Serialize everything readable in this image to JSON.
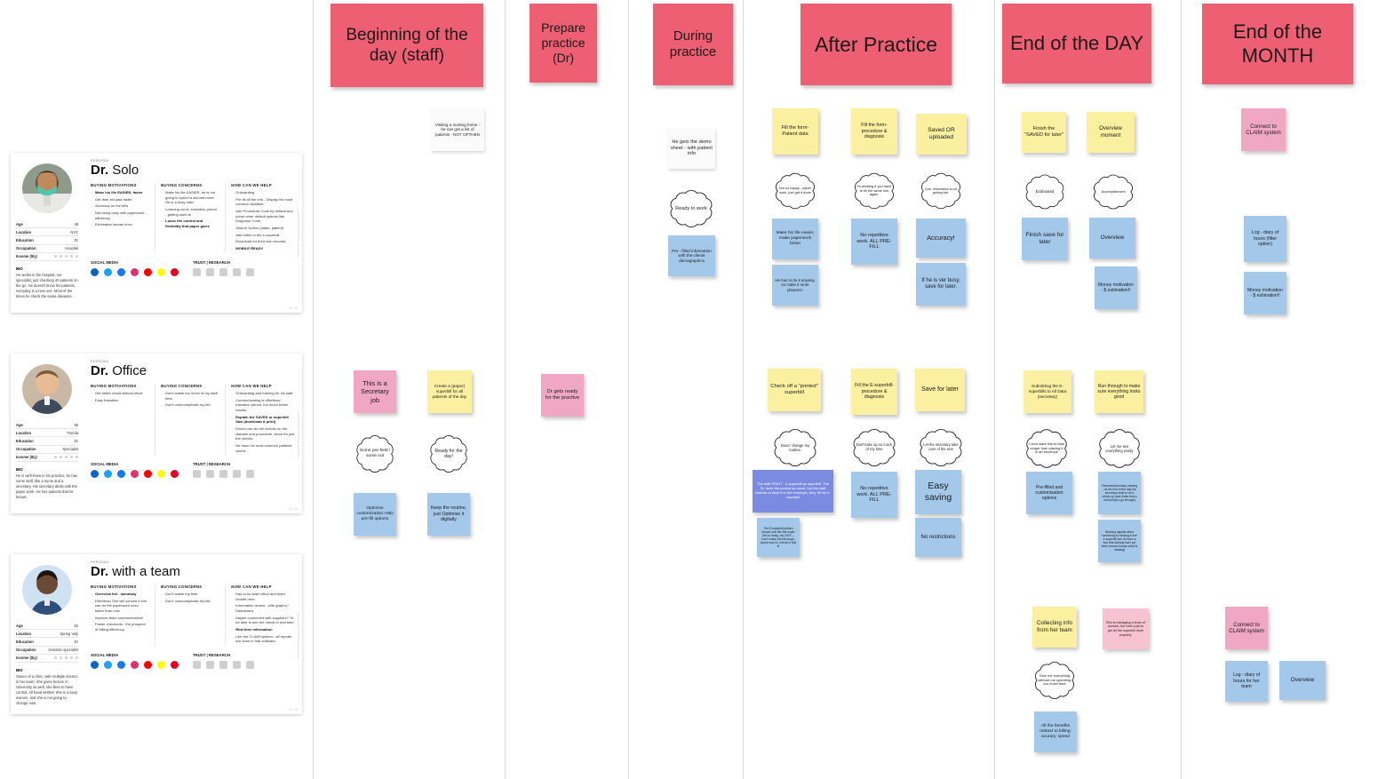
{
  "board": {
    "title": "User Journey Map - Superbill Personas",
    "colors": {
      "header_pink": "#ef5f73",
      "pink": "#f0a7c4",
      "pink_light": "#f7c2d2",
      "yellow": "#fbefa0",
      "blue": "#a4c8ea",
      "purple": "#7b8ce0",
      "white": "#fbfbfb"
    }
  },
  "columns": [
    {
      "id": "beginning",
      "label": "Beginning of the day (staff)"
    },
    {
      "id": "prepare",
      "label": "Prepare practice (Dr)"
    },
    {
      "id": "during",
      "label": "During practice"
    },
    {
      "id": "after",
      "label": "After Practice"
    },
    {
      "id": "endday",
      "label": "End of the DAY"
    },
    {
      "id": "endmonth",
      "label": "End of the MONTH"
    }
  ],
  "personas": [
    {
      "kicker": "PERSONA",
      "name_bold": "Dr.",
      "name_rest": "Solo",
      "attrs": [
        {
          "label": "Age",
          "value": "48"
        },
        {
          "label": "Location",
          "value": "NYC"
        },
        {
          "label": "Education",
          "value": "Dr"
        },
        {
          "label": "Occupation",
          "value": "Hospital"
        },
        {
          "label": "Income ($/y)",
          "value": ""
        }
      ],
      "bio_heading": "BIO",
      "bio": "He works in the hospital, not specialist, just checking 40 patients on the go. He doesn't know his patients, everyday is a new one. Most of the times he check the same diseases.",
      "col1_heading": "BUYING MOTIVATIONS",
      "col1": [
        {
          "text": "Make his life EASIER, faster",
          "bold": true
        },
        {
          "text": "Get their bill paid faster",
          "bold": false
        },
        {
          "text": "Accuracy on the bills",
          "bold": false
        },
        {
          "text": "Not being busy with paperwork - efficiency",
          "bold": false
        },
        {
          "text": "Eliminates human error",
          "bold": false
        }
      ],
      "col2_heading": "BUYING CONCERNS",
      "col2": [
        {
          "text": "Make his life EASIER, he is not going to spend a second more. He is a busy man!",
          "bold": false
        },
        {
          "text": "Learning curve, transition period - getting used to",
          "bold": false
        },
        {
          "text": "Loose the control and flexibility that paper gives",
          "bold": true
        }
      ],
      "col3_heading": "HOW CAN WE HELP",
      "col3": [
        {
          "text": "Onboarding",
          "bold": false
        },
        {
          "text": "Pre fill all the info - Display his most common facilities.",
          "bold": false
        },
        {
          "text": "Add Procedure Code by default and some other default options like Diagnose Code.",
          "bold": false
        },
        {
          "text": "Search Option (dates, patient)",
          "bold": false
        },
        {
          "text": "Add notes in the e-superbill.",
          "bold": false
        },
        {
          "text": "Download for their own records.",
          "bold": false
        },
        {
          "text": "MOBILE READY",
          "bold": true
        }
      ],
      "social_heading": "SOCIAL MEDIA",
      "trust_heading": "TRUST | RESEARCH",
      "social_icons": [
        "linkedin-icon",
        "twitter-icon",
        "facebook-icon",
        "instagram-icon",
        "youtube-icon",
        "snapchat-icon",
        "pinterest-icon"
      ],
      "trust_icons": [
        "store-icon",
        "monitor-icon",
        "gear-icon",
        "card-icon",
        "person-icon"
      ],
      "side_text": "www.xtensio.com/user-persona/",
      "page_num": "01 / 03"
    },
    {
      "kicker": "PERSONA",
      "name_bold": "Dr.",
      "name_rest": "Office",
      "attrs": [
        {
          "label": "Age",
          "value": "55"
        },
        {
          "label": "Location",
          "value": "Florida"
        },
        {
          "label": "Education",
          "value": "Dr"
        },
        {
          "label": "Occupation",
          "value": "Specialist"
        },
        {
          "label": "Income ($/y)",
          "value": ""
        }
      ],
      "bio_heading": "BIO",
      "bio": "He is well know in his practice, he has some staff, like a nurse and a secretary. His secretary deals with the paper work. He has patients that he knows.",
      "col1_heading": "BUYING MOTIVATIONS",
      "col1": [
        {
          "text": "Get better result without effort",
          "bold": false
        },
        {
          "text": "Easy transition",
          "bold": false
        }
      ],
      "col2_heading": "BUYING CONCERNS",
      "col2": [
        {
          "text": "Don't waste too much of my staff time.",
          "bold": false
        },
        {
          "text": "Don't overcomplicate my life.",
          "bold": false
        }
      ],
      "col3_heading": "HOW CAN WE HELP",
      "col3": [
        {
          "text": "Onboarding and training for his staff",
          "bold": false
        },
        {
          "text": "Communicating is effortless: transition period, too much better results.",
          "bold": false
        },
        {
          "text": "Explain the SAVED or superbill flow (download & print)",
          "bold": true
        },
        {
          "text": "Doctor can do the checks on the disease and procedure, since it's just the checks.",
          "bold": false
        },
        {
          "text": "He have his most common patients saved.",
          "bold": false
        }
      ],
      "social_heading": "SOCIAL MEDIA",
      "trust_heading": "TRUST | RESEARCH",
      "social_icons": [
        "linkedin-icon",
        "twitter-icon",
        "facebook-icon",
        "instagram-icon",
        "youtube-icon",
        "snapchat-icon",
        "pinterest-icon"
      ],
      "trust_icons": [
        "store-icon",
        "monitor-icon",
        "gear-icon",
        "card-icon",
        "person-icon"
      ],
      "side_text": "www.xtensio.com/user-persona/",
      "page_num": "02 / 03"
    },
    {
      "kicker": "PERSONA",
      "name_bold": "Dr.",
      "name_rest": "with a team",
      "attrs": [
        {
          "label": "Age",
          "value": "62"
        },
        {
          "label": "Location",
          "value": "Spring Valy"
        },
        {
          "label": "Education",
          "value": "Dr"
        },
        {
          "label": "Occupation",
          "value": "Geriatric specialist"
        },
        {
          "label": "Income ($/y)",
          "value": ""
        }
      ],
      "bio_heading": "BIO",
      "bio": "Owner of a clinic, with multiple doctors in her team. She gives lecture in University as well, she likes to have control. All hand written! She is a busy women, and she is not going to change now.",
      "col1_heading": "BUYING MOTIVATIONS",
      "col1": [
        {
          "text": "Overview list - summary",
          "bold": true
        },
        {
          "text": "Effortless! She will convert if she can do the paperwork even faster than now.",
          "bold": false
        },
        {
          "text": "Improve team communication!",
          "bold": false
        },
        {
          "text": "Faster checkouts - the prospect of billing efficiency.",
          "bold": false
        }
      ],
      "col2_heading": "BUYING CONCERNS",
      "col2": [
        {
          "text": "Don't waste my time.",
          "bold": false
        },
        {
          "text": "Don't overcomplicate my life.",
          "bold": false
        }
      ],
      "col3_heading": "HOW CAN WE HELP",
      "col3": [
        {
          "text": "Has to be team effort and team benefit here.",
          "bold": false
        },
        {
          "text": "Information review - with graphs? Dashboard",
          "bold": false
        },
        {
          "text": "Maybe connected with suppliers? To be able to see the needs in real time.",
          "bold": false
        },
        {
          "text": "Real time information",
          "bold": true
        },
        {
          "text": "Like the CLAIM system - all reports are done in that software.",
          "bold": false
        }
      ],
      "social_heading": "SOCIAL MEDIA",
      "trust_heading": "TRUST | RESEARCH",
      "social_icons": [
        "linkedin-icon",
        "twitter-icon",
        "facebook-icon",
        "instagram-icon",
        "youtube-icon",
        "snapchat-icon",
        "pinterest-icon"
      ],
      "trust_icons": [
        "store-icon",
        "monitor-icon",
        "gear-icon",
        "card-icon",
        "person-icon"
      ],
      "side_text": "www.xtensio.com/user-persona/",
      "page_num": "03 / 03"
    }
  ],
  "notes": {
    "solo": {
      "beginning_white": "Visiting a nursing home - he can get a list of patients - NOT OFTHEN",
      "during_white": "He gets the demo sheet - with patient info",
      "during_cloud": "Ready to work",
      "during_blue": "Pre - filled information with the clients demographics",
      "after_y1": "Fill the form- Patient data",
      "after_c1": "Not so happy - paper work, just get it done",
      "after_b1": "Make his life easier, make paperwork faster",
      "after_b1b": "He has to do it anyway, so make it more pleasent.",
      "after_y2": "Fill the form- procedure & diagnosis",
      "after_c2": "Frustrating if you have to fill the same info again.",
      "after_b2": "No repetitive work. ALL PRE-FILL",
      "after_y3": "Saved OR uploaded",
      "after_c3": "Cool, information is not getting lost.",
      "after_b3": "Accuracy!",
      "after_b3b": "If he is ver busy, save for later.",
      "day_y1": "Finish the \"SAVED for later\"",
      "day_c1": "Exahusted",
      "day_b1": "Finish save for later",
      "day_y2": "Overview moment",
      "day_c2": "Accomplishment",
      "day_b2": "Overview",
      "day_b2b": "Money motivation - $ estimation!!",
      "month_pink": "Connect to CLAIM system",
      "month_b1": "Log - diary of hours (filter option)",
      "month_b2": "Money motivation - $ estimation!!"
    },
    "office": {
      "beginning_pink": "This is a Secretary job",
      "beginning_cloud": "Some pre-field / some not",
      "beginning_blue": "Optimise customization AND pre-fill options",
      "beginning_yellow": "Create a (paper) superbill for all patients of the day",
      "beginning_cloud2": "Ready for the day!",
      "beginning_blue2": "Keep the routine, just Optimise it digitally",
      "prepare_pink": "Dr gets ready for the practive",
      "after_y1": "Check off a \"printed\" superbill",
      "after_c1": "Dooo' change my routine.",
      "after_p1": "The staff PRINT - e-superbill as superbill. The Dr. does his routine as usual, but the staff instead of send it in the envelope, they fill the e-superbill",
      "after_b1b": "The E-superbill printed should look like the super bill on friday, oct 2019 -- Don't make the life tough, check how Dr. needs to find it!",
      "after_y2": "Fill the E-superbill- procedure & diagnosis",
      "after_c2": "Don't take up so much of my time",
      "after_b2": "No repetitive work. ALL PRE-FILL",
      "after_y3": "Save for later",
      "after_c3": "Let the secretary take care of the rest",
      "after_b3": "Easy saving",
      "after_b3b": "No restrictions",
      "day_y1": "Submitting the E-superbills to All Data (secretary)",
      "day_c1": "I dont want this to take longer than placing it in an envelope",
      "day_b1": "Pre-filled and customisation options",
      "day_y2": "Run through to make sure everything looks good",
      "day_c2": "Let me see everything easily",
      "day_b2": "Overview/summary viewing - at the end of the day the secretary what to do a check-up (and make that a not boring to go through)",
      "day_b2b": "Warning signals when something is missing in the e-superbill (we do have a tool that already has't yet been known/ known what is missing)"
    },
    "team": {
      "day_y1": "Collecting info from her team",
      "day_c1": "Give me everything without me spending too much time",
      "day_b1": "All the benefits related to billing: acurary, speed",
      "day_pink": "She is managing a team of doctors, her next a job is get all the superbill done properly.",
      "month_pink": "Connect to CLAIM system",
      "month_b1": "Log - diary of hours for her team",
      "month_b2": "Overview"
    }
  }
}
